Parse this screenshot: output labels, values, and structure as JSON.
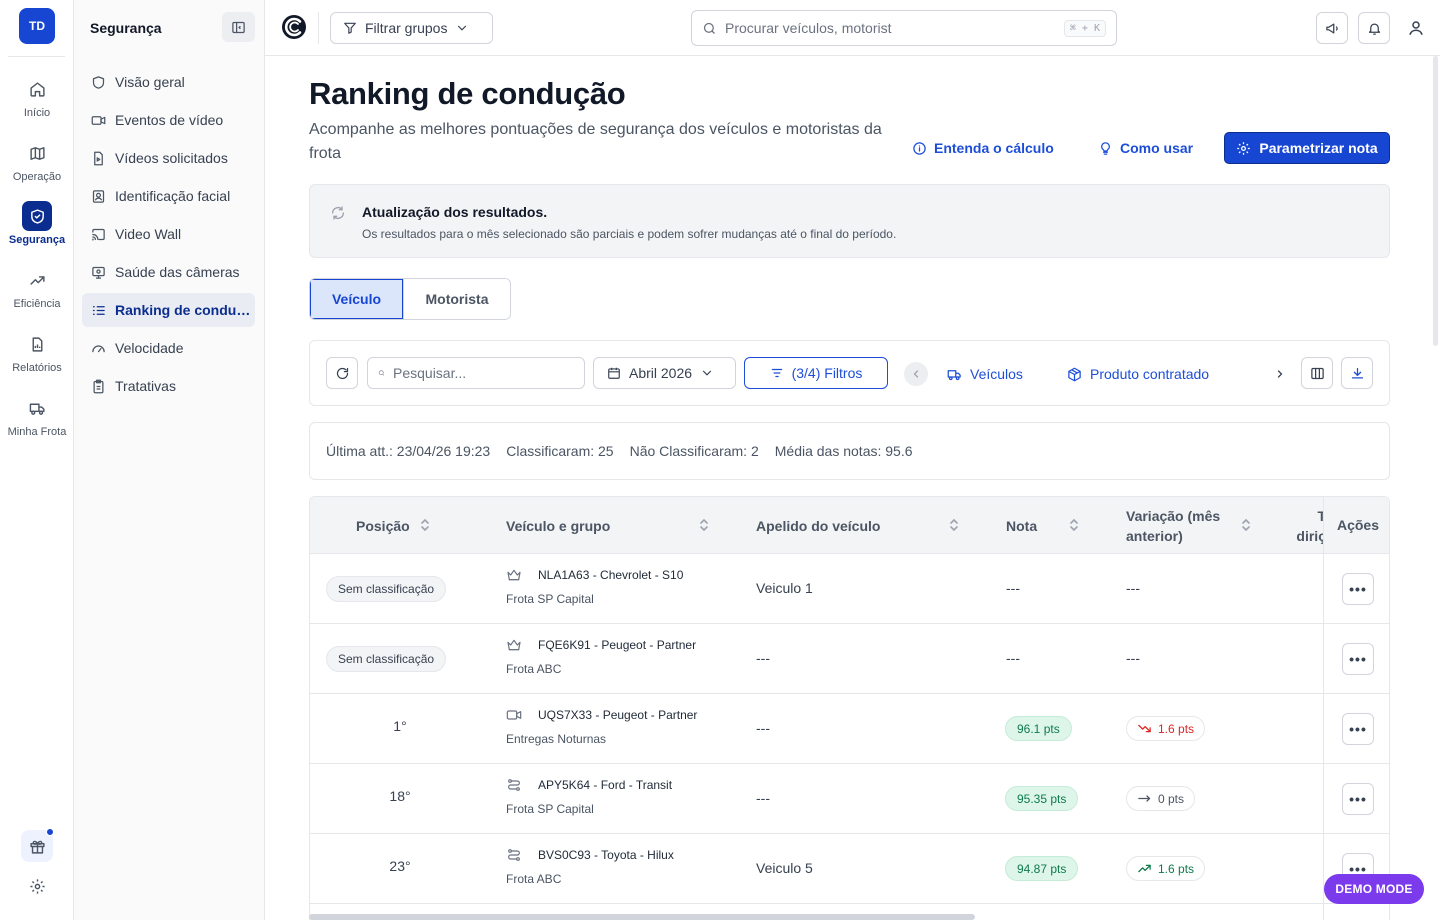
{
  "rail": {
    "logo": "TD",
    "items": [
      {
        "label": "Início",
        "icon": "home-icon"
      },
      {
        "label": "Operação",
        "icon": "map-icon"
      },
      {
        "label": "Segurança",
        "icon": "shield-icon",
        "active": true
      },
      {
        "label": "Eficiência",
        "icon": "trend-icon"
      },
      {
        "label": "Relatórios",
        "icon": "report-icon"
      },
      {
        "label": "Minha Frota",
        "icon": "truck-icon"
      }
    ]
  },
  "sidebar": {
    "title": "Segurança",
    "items": [
      {
        "label": "Visão geral",
        "icon": "shield-outline-icon"
      },
      {
        "label": "Eventos de vídeo",
        "icon": "video-icon"
      },
      {
        "label": "Vídeos solicitados",
        "icon": "file-video-icon"
      },
      {
        "label": "Identificação facial",
        "icon": "face-id-icon"
      },
      {
        "label": "Video Wall",
        "icon": "cast-icon"
      },
      {
        "label": "Saúde das câmeras",
        "icon": "monitor-icon"
      },
      {
        "label": "Ranking de condução",
        "icon": "list-ordered-icon",
        "active": true
      },
      {
        "label": "Velocidade",
        "icon": "gauge-icon"
      },
      {
        "label": "Tratativas",
        "icon": "clipboard-icon"
      }
    ]
  },
  "topbar": {
    "filter_groups": "Filtrar grupos",
    "search_placeholder": "Procurar veículos, motorist",
    "shortcut": "⌘ + K"
  },
  "page": {
    "title": "Ranking de condução",
    "subtitle": "Acompanhe as melhores pontuações de segurança dos veículos e motoristas da frota",
    "link_calc": "Entenda o cálculo",
    "link_howto": "Como usar",
    "primary": "Parametrizar nota"
  },
  "notice": {
    "title": "Atualização dos resultados.",
    "text": "Os resultados para o mês selecionado são parciais e podem sofrer mudanças até o final do período."
  },
  "tabs": {
    "vehicle": "Veículo",
    "driver": "Motorista"
  },
  "toolbar": {
    "search_placeholder": "Pesquisar...",
    "date": "Abril 2026",
    "filters": "(3/4) Filtros",
    "chip_vehicles": "Veículos",
    "chip_product": "Produto contratado"
  },
  "stats": {
    "last_update": "Última att.: 23/04/26 19:23",
    "classified": "Classificaram: 25",
    "not_classified": "Não Classificaram: 2",
    "average": "Média das notas: 95.6"
  },
  "table": {
    "headers": {
      "position": "Posição",
      "vehicle": "Veículo e grupo",
      "nickname": "Apelido do veículo",
      "score": "Nota",
      "variation": "Variação (mês anterior)",
      "truncated": "T\ndiriç",
      "actions": "Ações"
    },
    "rows": [
      {
        "position": "Sem classificação",
        "unranked": true,
        "vehicle_icon": "crown-icon",
        "vehicle": "NLA1A63 - Chevrolet - S10",
        "group": "Frota SP Capital",
        "nickname": "Veiculo 1",
        "score": "---",
        "variation": "---",
        "trend": "none"
      },
      {
        "position": "Sem classificação",
        "unranked": true,
        "vehicle_icon": "crown-icon",
        "vehicle": "FQE6K91 - Peugeot - Partner",
        "group": "Frota ABC",
        "nickname": "---",
        "score": "---",
        "variation": "---",
        "trend": "none"
      },
      {
        "position": "1°",
        "unranked": false,
        "vehicle_icon": "camera-icon",
        "vehicle": "UQS7X33 - Peugeot - Partner",
        "group": "Entregas Noturnas",
        "nickname": "---",
        "score": "96.1 pts",
        "variation": "1.6 pts",
        "trend": "down"
      },
      {
        "position": "18°",
        "unranked": false,
        "vehicle_icon": "route-icon",
        "vehicle": "APY5K64 - Ford - Transit",
        "group": "Frota SP Capital",
        "nickname": "---",
        "score": "95.35 pts",
        "variation": "0 pts",
        "trend": "flat"
      },
      {
        "position": "23°",
        "unranked": false,
        "vehicle_icon": "route-icon",
        "vehicle": "BVS0C93 - Toyota - Hilux",
        "group": "Frota ABC",
        "nickname": "Veiculo 5",
        "score": "94.87 pts",
        "variation": "1.6 pts",
        "trend": "up"
      }
    ]
  },
  "demo_badge": "DEMO MODE",
  "colors": {
    "primary": "#1746d3",
    "primary_dark": "#0b2d8f",
    "success": "#0e7a4b",
    "danger": "#dc2626",
    "demo": "#7c3aed"
  }
}
